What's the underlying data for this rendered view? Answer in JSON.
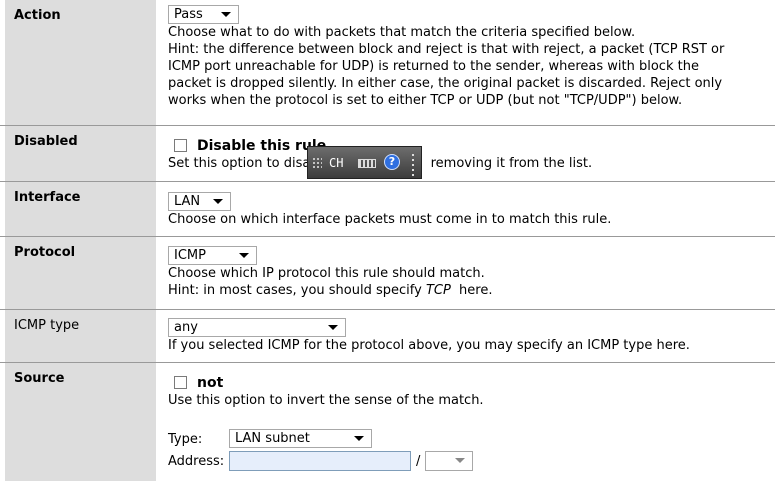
{
  "action": {
    "label": "Action",
    "selected": "Pass",
    "desc": [
      "Choose what to do with packets that match the criteria specified below.",
      "Hint: the difference between block and reject is that with reject, a packet (TCP RST or",
      "ICMP port unreachable for UDP) is returned to the sender, whereas with block the",
      "packet is dropped silently. In either case, the original packet is discarded. Reject only",
      "works when the protocol is set to either TCP or UDP (but not \"TCP/UDP\") below."
    ]
  },
  "disabled": {
    "label": "Disabled",
    "checkbox_label": "Disable this rule",
    "checked": false,
    "desc_before": "Set this option to disab",
    "desc_after": "removing it from the list."
  },
  "interface": {
    "label": "Interface",
    "selected": "LAN",
    "desc": "Choose on which interface packets must come in to match this rule."
  },
  "protocol": {
    "label": "Protocol",
    "selected": "ICMP",
    "desc1": "Choose which IP protocol this rule should match.",
    "hint_before": "Hint: in most cases, you should specify ",
    "hint_em": "TCP",
    "hint_after": "  here."
  },
  "icmp_type": {
    "label": "ICMP type",
    "selected": "any",
    "desc": "If you selected ICMP for the protocol above, you may specify an ICMP type here."
  },
  "source": {
    "label": "Source",
    "not_label": "not",
    "not_checked": false,
    "desc": "Use this option to invert the sense of the match.",
    "type_label": "Type:",
    "type_selected": "LAN subnet",
    "address_label": "Address:",
    "address_value": "",
    "slash": "/",
    "mask_selected": ""
  },
  "ime_toolbar": {
    "lang": "CH",
    "help": "?",
    "icons": [
      "grip-icon",
      "keyboard-icon",
      "help-icon",
      "options-icon"
    ]
  }
}
